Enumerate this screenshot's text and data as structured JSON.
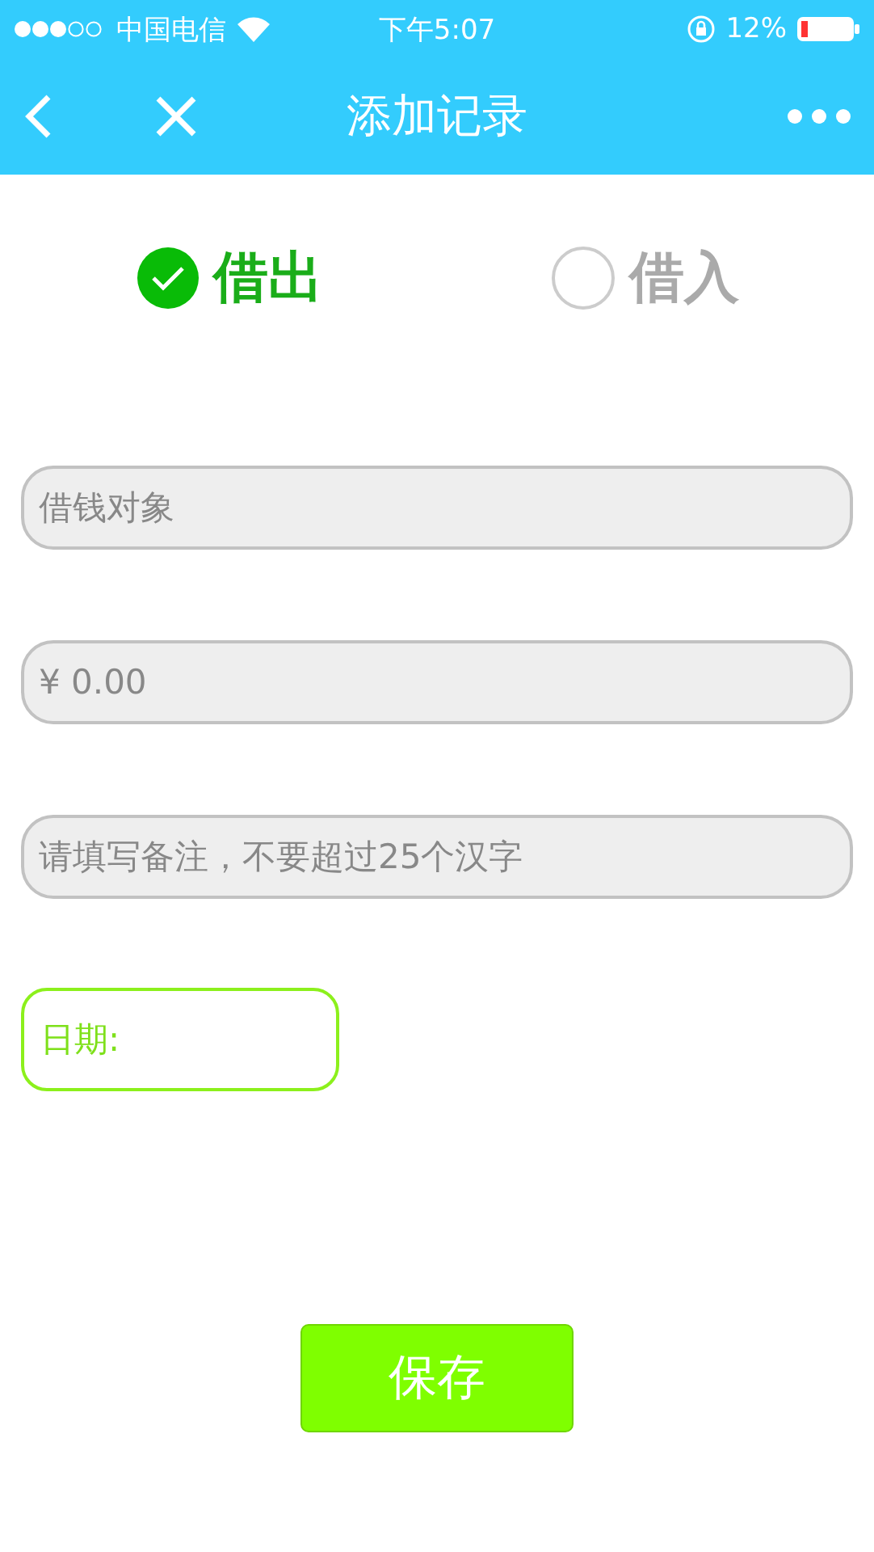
{
  "status_bar": {
    "carrier": "中国电信",
    "time": "下午5:07",
    "battery": "12%"
  },
  "nav": {
    "title": "添加记录"
  },
  "direction": [
    {
      "label": "借出",
      "selected": true
    },
    {
      "label": "借入",
      "selected": false
    }
  ],
  "fields": [
    {
      "placeholder": "借钱对象"
    },
    {
      "placeholder": "¥ 0.00"
    },
    {
      "placeholder": "请填写备注，不要超过25个汉字"
    }
  ],
  "date": {
    "label": "日期:"
  },
  "save_button": "保存"
}
